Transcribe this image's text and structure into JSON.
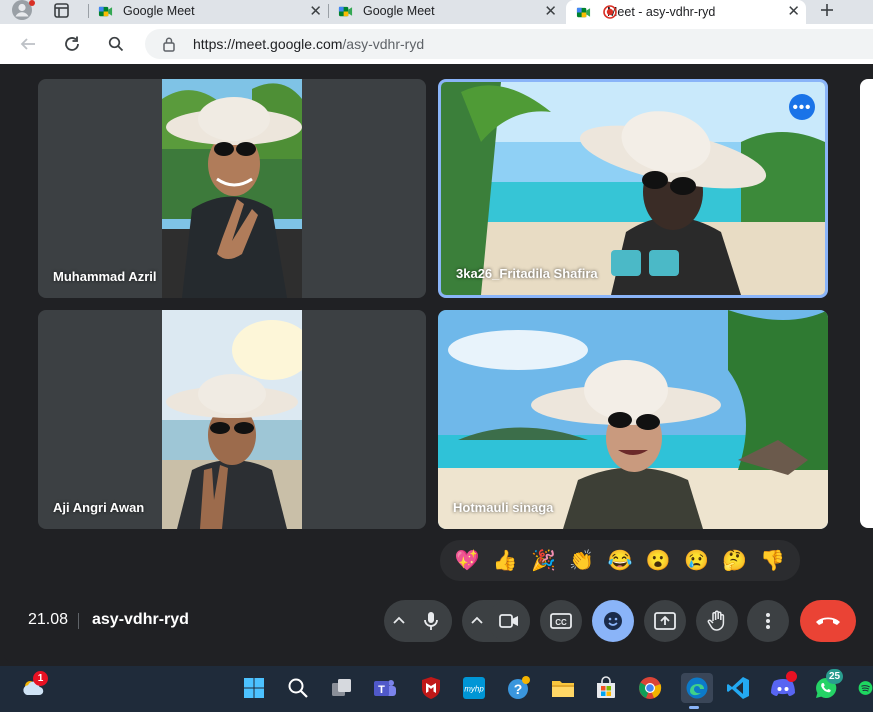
{
  "browser": {
    "tabs": [
      {
        "title": "Google Meet",
        "active": false
      },
      {
        "title": "Google Meet",
        "active": false
      },
      {
        "title": "Meet - asy-vdhr-ryd",
        "active": true
      }
    ],
    "new_tab_icon": "plus-icon",
    "url_host": "https://meet.google.com",
    "url_path": "/asy-vdhr-ryd"
  },
  "meet": {
    "participants": [
      {
        "name": "Muhammad Azril",
        "background": "tropical-beach"
      },
      {
        "name": "3ka26_Fritadila Shafira",
        "background": "tropical-beach",
        "speaking": true
      },
      {
        "name": "Aji Angri Awan",
        "background": "sky"
      },
      {
        "name": "Hotmauli sinaga",
        "background": "tropical-beach"
      }
    ],
    "reactions": [
      "💖",
      "👍",
      "🎉",
      "👏",
      "😂",
      "😮",
      "😢",
      "🤔",
      "👎"
    ],
    "time": "21.08",
    "meeting_code": "asy-vdhr-ryd",
    "controls": [
      "microphone",
      "camera",
      "captions",
      "reactions",
      "present",
      "raise-hand",
      "more-options",
      "leave-call"
    ]
  },
  "taskbar": {
    "weather_badge": "1",
    "discord_badge": "",
    "whatsapp_badge": "25",
    "items": [
      "weather",
      "start",
      "search",
      "task-view",
      "teams",
      "mcafee",
      "myhp",
      "tips",
      "file-explorer",
      "microsoft-store",
      "chrome",
      "edge",
      "vscode",
      "discord",
      "whatsapp",
      "spotify"
    ]
  },
  "colors": {
    "accent": "#8ab4f8",
    "end_call": "#ea4335",
    "tile_bg": "#3c4043"
  }
}
